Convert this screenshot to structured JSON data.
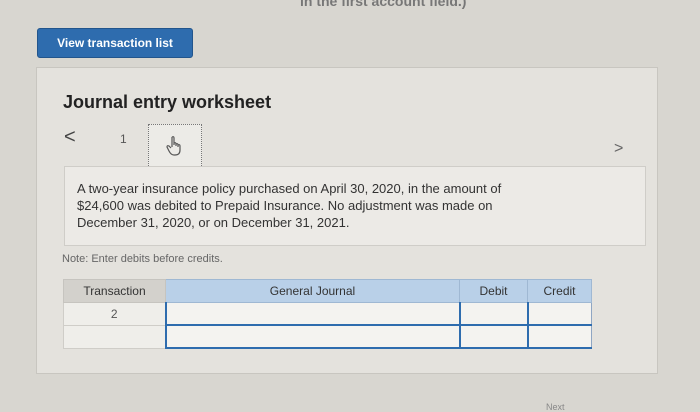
{
  "top_fragment": "in the first account field.)",
  "view_button": "View transaction list",
  "worksheet": {
    "title": "Journal entry worksheet",
    "nav_prev": "<",
    "nav_next": ">",
    "page_number": "1",
    "description": "A two-year insurance policy purchased on April 30, 2020, in the amount of $24,600 was debited to Prepaid Insurance. No adjustment was made on December 31, 2020, or on December 31, 2021.",
    "note": "Note: Enter debits before credits."
  },
  "table": {
    "headers": [
      "Transaction",
      "General Journal",
      "Debit",
      "Credit"
    ],
    "rows": [
      {
        "transaction": "2"
      },
      {
        "transaction": ""
      }
    ]
  },
  "bottom": {
    "next_label": "Next"
  }
}
